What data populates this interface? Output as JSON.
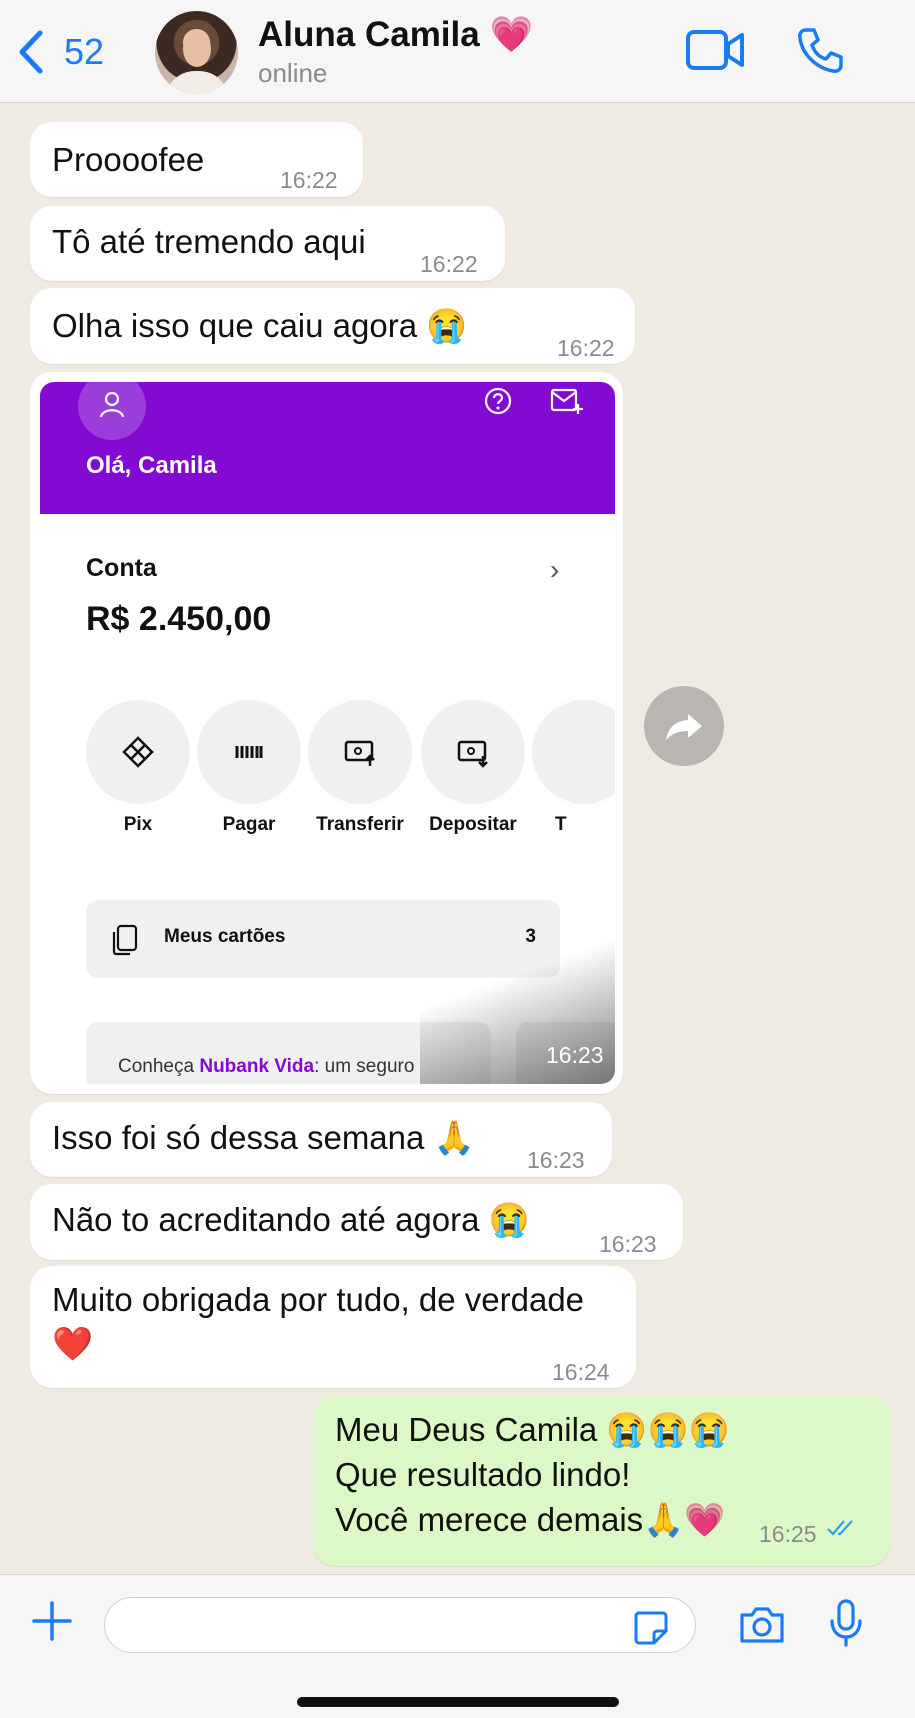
{
  "header": {
    "back_count": "52",
    "contact_name": "Aluna Camila 💗",
    "status": "online"
  },
  "messages": [
    {
      "text": "Proooofee",
      "time": "16:22"
    },
    {
      "text": "Tô até tremendo aqui",
      "time": "16:22"
    },
    {
      "text": "Olha isso que caiu agora 😭",
      "time": "16:22"
    },
    {
      "text": "Isso foi só dessa semana 🙏",
      "time": "16:23"
    },
    {
      "text": "Não to acreditando até agora 😭",
      "time": "16:23"
    },
    {
      "text_line1": "Muito obrigada por tudo, de verdade",
      "text_line2": "❤️",
      "time": "16:24"
    }
  ],
  "outgoing": {
    "line1": "Meu Deus Camila 😭😭😭",
    "line2": "Que resultado lindo!",
    "line3": "Você merece demais🙏💗",
    "time": "16:25",
    "status_icon": "double-check-read"
  },
  "screenshot": {
    "time": "16:23",
    "greeting": "Olá, Camila",
    "account_label": "Conta",
    "balance": "R$ 2.450,00",
    "actions": [
      "Pix",
      "Pagar",
      "Transferir",
      "Depositar",
      "T"
    ],
    "cards_label": "Meus cartões",
    "cards_count": "3",
    "promo_prefix": "Conheça ",
    "promo_brand": "Nubank Vida",
    "promo_suffix": ": um seguro",
    "brand_color": "#820ad1"
  },
  "input": {
    "placeholder": ""
  },
  "colors": {
    "accent": "#1a7cf5",
    "incoming_bubble": "#ffffff",
    "outgoing_bubble": "#dcf8c6",
    "chat_bg": "#efeae2"
  }
}
